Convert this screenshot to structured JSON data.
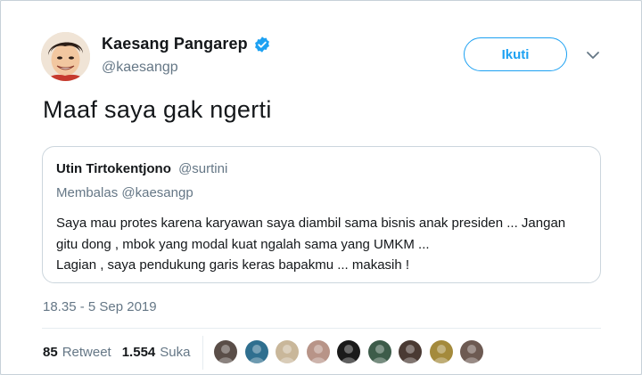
{
  "author": {
    "display_name": "Kaesang Pangarep",
    "handle": "@kaesangp",
    "verified": true,
    "avatar_icon": "caricature-avatar"
  },
  "follow_label": "Ikuti",
  "tweet_text": "Maaf saya gak ngerti",
  "quoted": {
    "display_name": "Utin Tirtokentjono",
    "handle": "@surtini",
    "reply_prefix": "Membalas",
    "reply_to": "@kaesangp",
    "lines": [
      "Saya mau protes karena karyawan saya diambil sama bisnis anak presiden ... Jangan",
      "gitu dong , mbok yang modal kuat ngalah sama yang UMKM ...",
      "Lagian , saya pendukung garis keras bapakmu ... makasih !"
    ]
  },
  "timestamp": "18.35 - 5 Sep 2019",
  "stats": {
    "retweets": "85",
    "retweets_label": "Retweet",
    "likes": "1.554",
    "likes_label": "Suka"
  },
  "likers": [
    {
      "icon": "liker-avatar-1",
      "color": "#5a4e48"
    },
    {
      "icon": "liker-avatar-2",
      "color": "#2f6f8f"
    },
    {
      "icon": "liker-avatar-3",
      "color": "#c9b79a"
    },
    {
      "icon": "liker-avatar-4",
      "color": "#b89488"
    },
    {
      "icon": "liker-avatar-5",
      "color": "#1a1a1a"
    },
    {
      "icon": "liker-avatar-6",
      "color": "#3d5c4a"
    },
    {
      "icon": "liker-avatar-7",
      "color": "#4a3a33"
    },
    {
      "icon": "liker-avatar-8",
      "color": "#a48a3c"
    },
    {
      "icon": "liker-avatar-9",
      "color": "#6d5a52"
    }
  ],
  "colors": {
    "accent": "#1da1f2",
    "secondary_text": "#657786",
    "primary_text": "#14171a"
  }
}
